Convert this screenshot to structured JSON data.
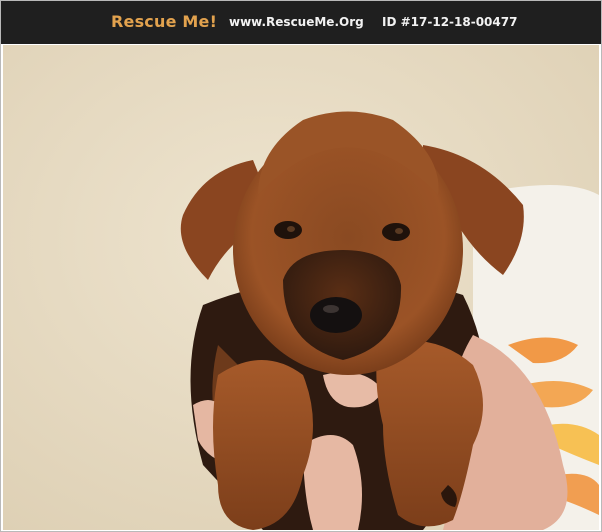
{
  "header": {
    "brand": "Rescue Me!",
    "site_url": "www.RescueMe.Org",
    "listing_id": "ID #17-12-18-00477"
  },
  "photo": {
    "subject": "puppy-photo",
    "colors": {
      "background": "#e8dcc3",
      "fur": "#9a4f22",
      "fur_dark": "#3a2012",
      "skin": "#e3b29e",
      "towel_accent": "#f0892a"
    }
  }
}
